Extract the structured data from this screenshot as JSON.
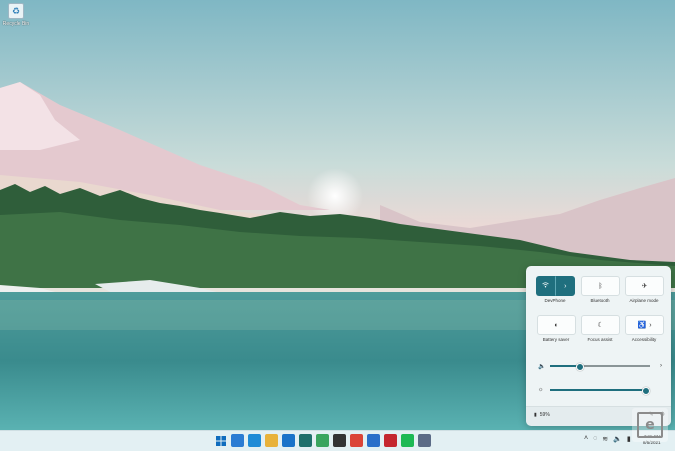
{
  "desktop": {
    "recycle_bin_label": "Recycle Bin"
  },
  "quick_settings": {
    "tiles": [
      {
        "label": "DevPhone",
        "icon": "wifi-icon",
        "on": true
      },
      {
        "label": "Bluetooth",
        "icon": "bluetooth-icon",
        "on": false
      },
      {
        "label": "Airplane mode",
        "icon": "airplane-icon",
        "on": false
      },
      {
        "label": "Battery saver",
        "icon": "battery-saver-icon",
        "on": false
      },
      {
        "label": "Focus assist",
        "icon": "moon-icon",
        "on": false
      },
      {
        "label": "Accessibility",
        "icon": "accessibility-icon",
        "on": false
      }
    ],
    "volume_level": 0.3,
    "brightness_level": 0.96,
    "battery_text": "59%"
  },
  "taskbar": {
    "apps": [
      {
        "name": "start",
        "color": "#0f6cbd"
      },
      {
        "name": "widgets",
        "color": "#2b7cd3"
      },
      {
        "name": "edge",
        "color": "#1f8bd6"
      },
      {
        "name": "file-explorer",
        "color": "#e8b23a"
      },
      {
        "name": "mail",
        "color": "#1a73c9"
      },
      {
        "name": "app-teal",
        "color": "#1e6f6b"
      },
      {
        "name": "app-green",
        "color": "#3aa55f"
      },
      {
        "name": "store",
        "color": "#333333"
      },
      {
        "name": "chrome",
        "color": "#db4437"
      },
      {
        "name": "app-blue",
        "color": "#2a6fc9"
      },
      {
        "name": "app-red",
        "color": "#c4262e"
      },
      {
        "name": "spotify",
        "color": "#1db954"
      },
      {
        "name": "settings",
        "color": "#5b6b86"
      }
    ],
    "clock_time": "7:05 PM",
    "clock_date": "8/5/2021"
  },
  "colors": {
    "accent": "#1f6f7e",
    "taskbar_bg": "#e3f0f3"
  }
}
